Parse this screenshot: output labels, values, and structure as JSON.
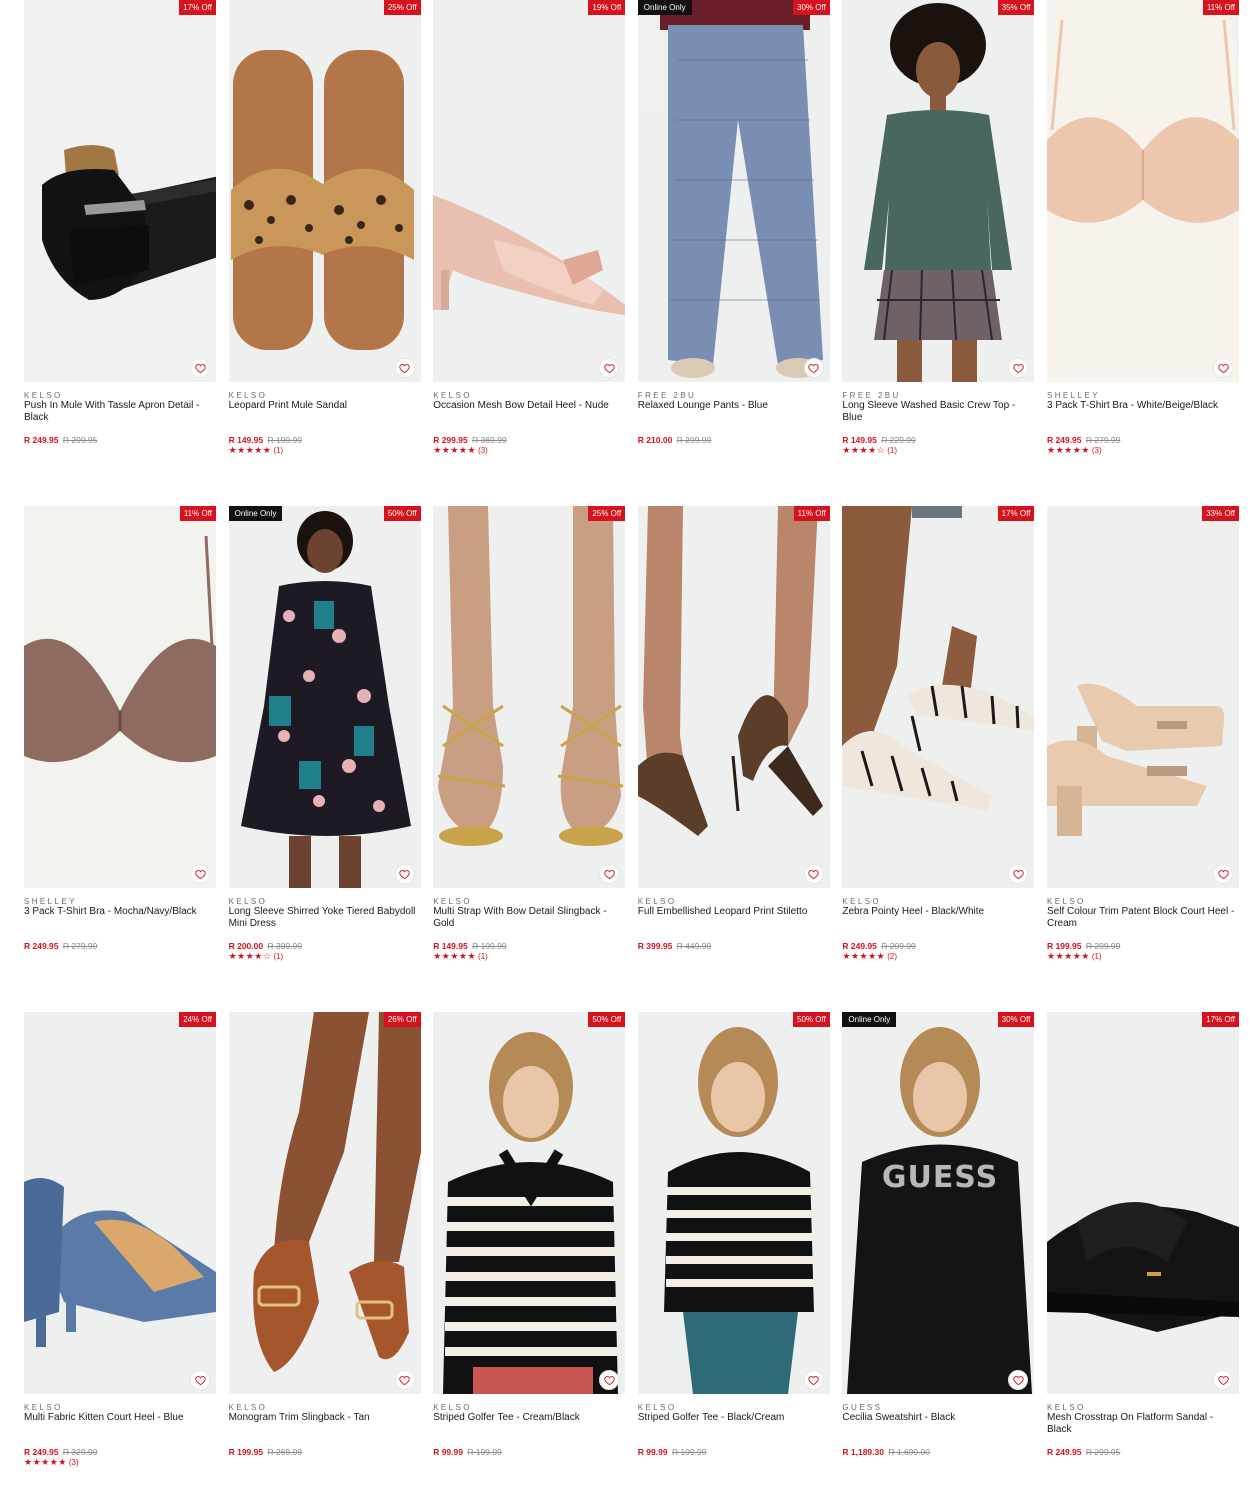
{
  "colors": {
    "accent": "#d6121e",
    "badge_dark": "#111111",
    "text": "#1a1a1a",
    "muted": "#8a8a8a"
  },
  "icons": {
    "wishlist": "heart-icon",
    "rating": "star-icon"
  },
  "products": [
    {
      "badge": "17% Off",
      "online_only": "",
      "brand": "KELSO",
      "name": "Push In Mule With Tassle Apron Detail - Black",
      "price": "R 249.95",
      "was": "R 299.95",
      "stars": "",
      "reviews": "",
      "rating": 0
    },
    {
      "badge": "25% Off",
      "online_only": "",
      "brand": "KELSO",
      "name": "Leopard Print Mule Sandal",
      "price": "R 149.95",
      "was": "R 199.99",
      "stars": "★★★★★",
      "reviews": "(1)",
      "rating": 5
    },
    {
      "badge": "19% Off",
      "online_only": "",
      "brand": "KELSO",
      "name": "Occasion Mesh Bow Detail Heel - Nude",
      "price": "R 299.95",
      "was": "R 369.99",
      "stars": "★★★★★",
      "reviews": "(3)",
      "rating": 5
    },
    {
      "badge": "30% Off",
      "online_only": "Online Only",
      "brand": "FREE 2BU",
      "name": "Relaxed Lounge Pants - Blue",
      "price": "R 210.00",
      "was": "R 299.99",
      "stars": "",
      "reviews": "",
      "rating": 0
    },
    {
      "badge": "35% Off",
      "online_only": "",
      "brand": "FREE 2BU",
      "name": "Long Sleeve Washed Basic Crew Top - Blue",
      "price": "R 149.95",
      "was": "R 229.99",
      "stars": "★★★★☆",
      "reviews": "(1)",
      "rating": 4
    },
    {
      "badge": "11% Off",
      "online_only": "",
      "brand": "SHELLEY",
      "name": "3 Pack T-Shirt Bra - White/Beige/Black",
      "price": "R 249.95",
      "was": "R 279.99",
      "stars": "★★★★★",
      "reviews": "(3)",
      "rating": 5
    },
    {
      "badge": "11% Off",
      "online_only": "",
      "brand": "SHELLEY",
      "name": "3 Pack T-Shirt Bra - Mocha/Navy/Black",
      "price": "R 249.95",
      "was": "R 279.99",
      "stars": "",
      "reviews": "",
      "rating": 0
    },
    {
      "badge": "50% Off",
      "online_only": "Online Only",
      "brand": "KELSO",
      "name": "Long Sleeve Shirred Yoke Tiered Babydoll Mini Dress",
      "price": "R 200.00",
      "was": "R 399.99",
      "stars": "★★★★☆",
      "reviews": "(1)",
      "rating": 4
    },
    {
      "badge": "25% Off",
      "online_only": "",
      "brand": "KELSO",
      "name": "Multi Strap With Bow Detail Slingback - Gold",
      "price": "R 149.95",
      "was": "R 199.99",
      "stars": "★★★★★",
      "reviews": "(1)",
      "rating": 5
    },
    {
      "badge": "11% Off",
      "online_only": "",
      "brand": "KELSO",
      "name": "Full Embellished Leopard Print Stiletto",
      "price": "R 399.95",
      "was": "R 449.99",
      "stars": "",
      "reviews": "",
      "rating": 0
    },
    {
      "badge": "17% Off",
      "online_only": "",
      "brand": "KELSO",
      "name": "Zebra Pointy Heel - Black/White",
      "price": "R 249.95",
      "was": "R 299.99",
      "stars": "★★★★★",
      "reviews": "(2)",
      "rating": 5
    },
    {
      "badge": "33% Off",
      "online_only": "",
      "brand": "KELSO",
      "name": "Self Colour Trim Patent Block Court Heel - Cream",
      "price": "R 199.95",
      "was": "R 299.99",
      "stars": "★★★★★",
      "reviews": "(1)",
      "rating": 5
    },
    {
      "badge": "24% Off",
      "online_only": "",
      "brand": "KELSO",
      "name": "Multi Fabric Kitten Court Heel - Blue",
      "price": "R 249.95",
      "was": "R 329.99",
      "stars": "★★★★★",
      "reviews": "(3)",
      "rating": 5
    },
    {
      "badge": "26% Off",
      "online_only": "",
      "brand": "KELSO",
      "name": "Monogram Trim Slingback - Tan",
      "price": "R 199.95",
      "was": "R 269.99",
      "stars": "",
      "reviews": "",
      "rating": 0
    },
    {
      "badge": "50% Off",
      "online_only": "",
      "brand": "KELSO",
      "name": "Striped Golfer Tee - Cream/Black",
      "price": "R 99.99",
      "was": "R 199.99",
      "stars": "",
      "reviews": "",
      "rating": 0
    },
    {
      "badge": "50% Off",
      "online_only": "",
      "brand": "KELSO",
      "name": "Striped Golfer Tee - Black/Cream",
      "price": "R 99.99",
      "was": "R 199.99",
      "stars": "",
      "reviews": "",
      "rating": 0
    },
    {
      "badge": "30% Off",
      "online_only": "Online Only",
      "brand": "GUESS",
      "name": "Cecilia Sweatshirt - Black",
      "price": "R 1,189.30",
      "was": "R 1,699.00",
      "stars": "",
      "reviews": "",
      "rating": 0,
      "image_text": "GUESS"
    },
    {
      "badge": "17% Off",
      "online_only": "",
      "brand": "KELSO",
      "name": "Mesh Crosstrap On Flatform Sandal - Black",
      "price": "R 249.95",
      "was": "R 299.95",
      "stars": "",
      "reviews": "",
      "rating": 0
    }
  ]
}
